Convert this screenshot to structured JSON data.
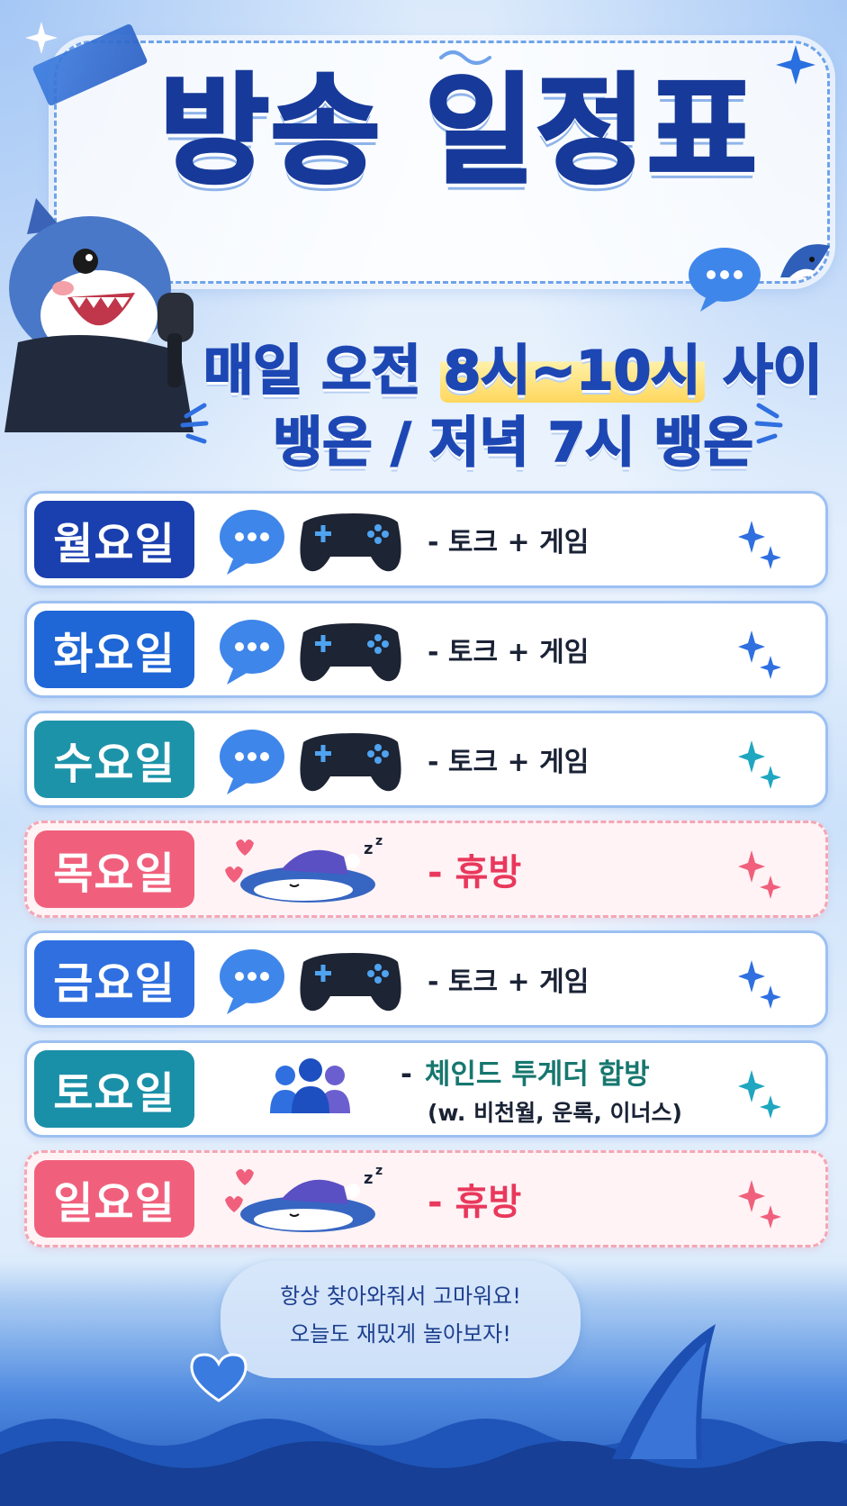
{
  "title": "방송 일정표",
  "subtitle": {
    "line1_pre": "매일 오전 ",
    "line1_highlight": "8시~10시",
    "line1_post": " 사이",
    "line2": "뱅온 / 저녁 7시 뱅온"
  },
  "colors": {
    "title": "#173a9a",
    "monday": "#1a3fae",
    "tuesday": "#1f66d6",
    "wednesday": "#1d93a9",
    "off_day": "#f0607c",
    "friday": "#2f6fe0",
    "saturday": "#1a8fa8",
    "off_text": "#e9385c",
    "collab_text": "#17776f"
  },
  "schedule": [
    {
      "day": "월요일",
      "desc": "- 토크 + 게임",
      "type": "stream",
      "icons": [
        "chat-bubble-icon",
        "gamepad-icon"
      ]
    },
    {
      "day": "화요일",
      "desc": "- 토크 + 게임",
      "type": "stream",
      "icons": [
        "chat-bubble-icon",
        "gamepad-icon"
      ]
    },
    {
      "day": "수요일",
      "desc": "- 토크 + 게임",
      "type": "stream",
      "icons": [
        "chat-bubble-icon",
        "gamepad-icon"
      ]
    },
    {
      "day": "목요일",
      "desc": "- 휴방",
      "type": "off",
      "icons": [
        "sleeping-shark-icon",
        "heart-icon"
      ]
    },
    {
      "day": "금요일",
      "desc": "- 토크 + 게임",
      "type": "stream",
      "icons": [
        "chat-bubble-icon",
        "gamepad-icon"
      ]
    },
    {
      "day": "토요일",
      "desc_dash": "-",
      "desc": "체인드 투게더 합방",
      "desc_sub": "(w. 비천월, 운록, 이너스)",
      "type": "collab",
      "icons": [
        "group-icon"
      ]
    },
    {
      "day": "일요일",
      "desc": "- 휴방",
      "type": "off",
      "icons": [
        "sleeping-shark-icon",
        "heart-icon"
      ]
    }
  ],
  "footer": {
    "line1": "항상 찾아와줘서 고마워요!",
    "line2": "오늘도 재밌게 놀아보자!"
  }
}
